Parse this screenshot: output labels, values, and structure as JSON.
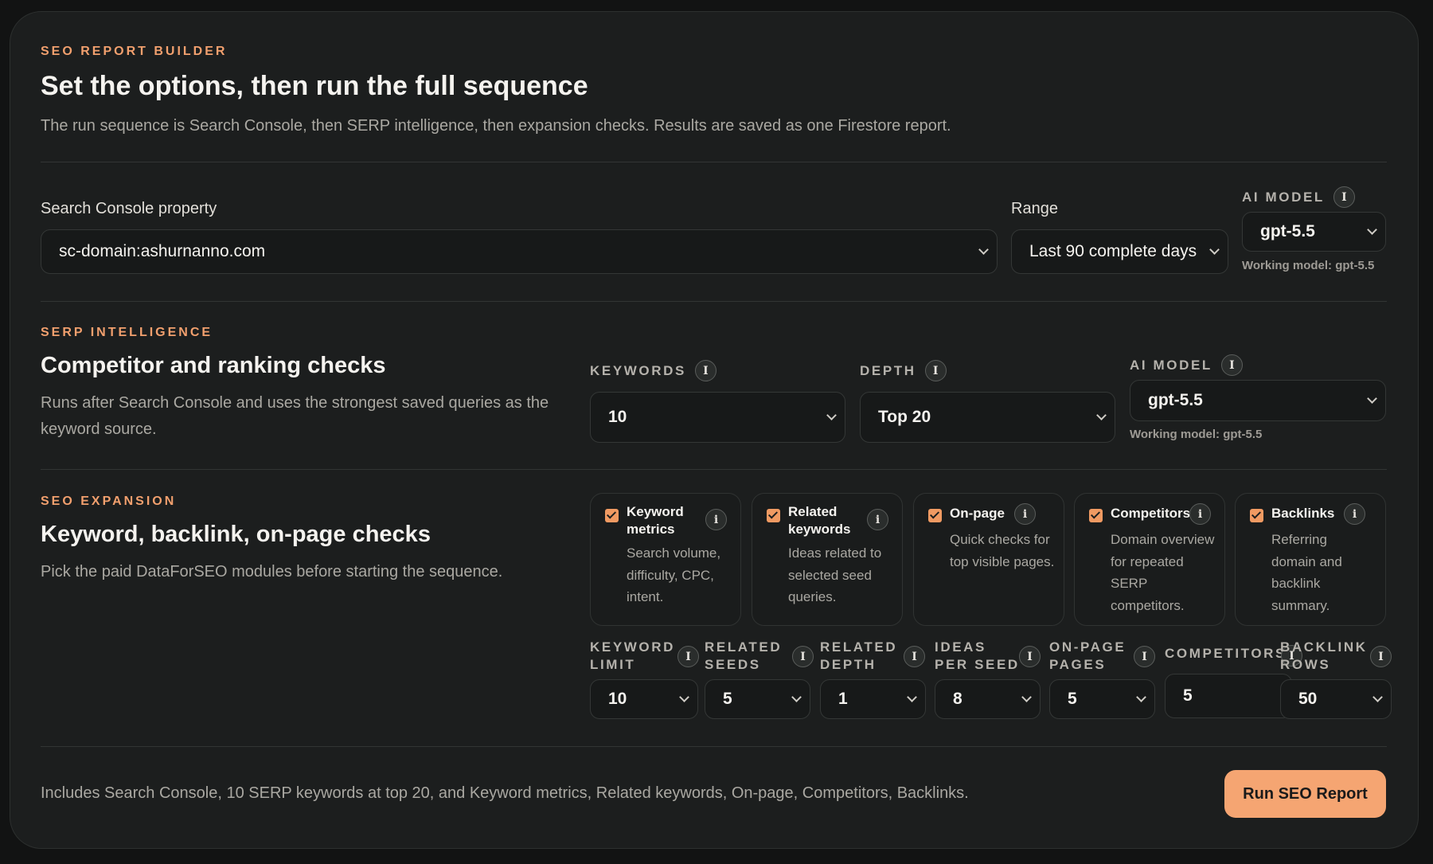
{
  "header": {
    "eyebrow": "SEO REPORT BUILDER",
    "title": "Set the options, then run the full sequence",
    "description": "The run sequence is Search Console, then SERP intelligence, then expansion checks. Results are saved as one Firestore report."
  },
  "property": {
    "label": "Search Console property",
    "value": "sc-domain:ashurnanno.com"
  },
  "range": {
    "label": "Range",
    "value": "Last 90 complete days"
  },
  "top_model": {
    "label": "AI MODEL",
    "info": "i",
    "value": "gpt-5.5",
    "working": "Working model: gpt-5.5"
  },
  "serp": {
    "eyebrow": "SERP INTELLIGENCE",
    "title": "Competitor and ranking checks",
    "description": "Runs after Search Console and uses the strongest saved queries as the keyword source.",
    "keywords": {
      "label": "KEYWORDS",
      "info": "i",
      "value": "10"
    },
    "depth": {
      "label": "DEPTH",
      "info": "i",
      "value": "Top 20"
    },
    "model": {
      "label": "AI MODEL",
      "info": "i",
      "value": "gpt-5.5",
      "working": "Working model: gpt-5.5"
    }
  },
  "expansion": {
    "eyebrow": "SEO EXPANSION",
    "title": "Keyword, backlink, on-page checks",
    "description": "Pick the paid DataForSEO modules before starting the sequence.",
    "modules": [
      {
        "title": "Keyword metrics",
        "description": "Search volume, difficulty, CPC, intent.",
        "checked": true,
        "info": "i"
      },
      {
        "title": "Related keywords",
        "description": "Ideas related to selected seed queries.",
        "checked": true,
        "info": "i"
      },
      {
        "title": "On-page",
        "description": "Quick checks for top visible pages.",
        "checked": true,
        "info": "i"
      },
      {
        "title": "Competitors",
        "description": "Domain overview for repeated SERP competitors.",
        "checked": true,
        "info": "i"
      },
      {
        "title": "Backlinks",
        "description": "Referring domain and backlink summary.",
        "checked": true,
        "info": "i"
      }
    ],
    "settings": [
      {
        "label_line1": "KEYWORD",
        "label_line2": "LIMIT",
        "value": "10",
        "info": "i"
      },
      {
        "label_line1": "RELATED",
        "label_line2": "SEEDS",
        "value": "5",
        "info": "i"
      },
      {
        "label_line1": "RELATED",
        "label_line2": "DEPTH",
        "value": "1",
        "info": "i"
      },
      {
        "label_line1": "IDEAS",
        "label_line2": "PER SEED",
        "value": "8",
        "info": "i"
      },
      {
        "label_line1": "ON-PAGE",
        "label_line2": "PAGES",
        "value": "5",
        "info": "i"
      },
      {
        "label_line1": "COMPETITORS",
        "label_line2": "",
        "value": "5",
        "info": "i"
      },
      {
        "label_line1": "BACKLINK",
        "label_line2": "ROWS",
        "value": "50",
        "info": "i"
      }
    ]
  },
  "footer": {
    "summary": "Includes Search Console, 10 SERP keywords at top 20, and Keyword metrics, Related keywords, On-page, Competitors, Backlinks.",
    "run_label": "Run SEO Report"
  },
  "colors": {
    "accent": "#f2a06e",
    "button": "#f5a572",
    "background": "#1c1e1e"
  }
}
